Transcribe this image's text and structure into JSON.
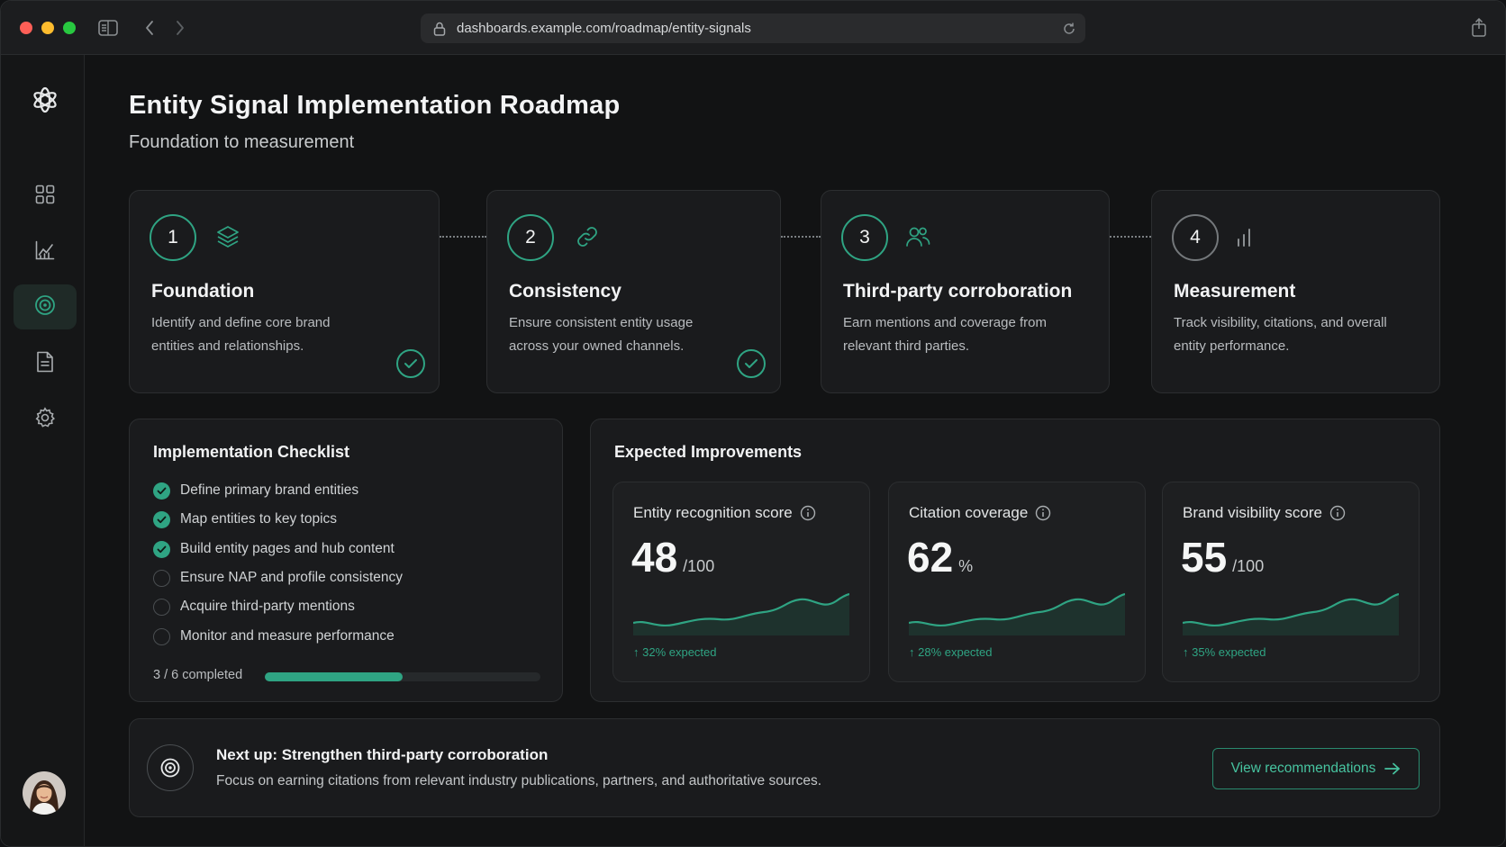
{
  "browser": {
    "url": "dashboards.example.com/roadmap/entity-signals"
  },
  "sidebar": {
    "items": [
      {
        "name": "dashboard",
        "icon": "grid-icon"
      },
      {
        "name": "analytics",
        "icon": "chart-icon"
      },
      {
        "name": "roadmap",
        "icon": "target-icon",
        "active": true
      },
      {
        "name": "documents",
        "icon": "document-icon"
      },
      {
        "name": "settings",
        "icon": "gear-icon"
      }
    ]
  },
  "page": {
    "title": "Entity Signal Implementation Roadmap",
    "subtitle": "Foundation to measurement"
  },
  "steps": [
    {
      "number": "1",
      "icon": "layers-icon",
      "title": "Foundation",
      "description": "Identify and define core brand entities and relationships.",
      "completed": true
    },
    {
      "number": "2",
      "icon": "link-icon",
      "title": "Consistency",
      "description": "Ensure consistent entity usage across your owned channels.",
      "completed": true
    },
    {
      "number": "3",
      "icon": "users-icon",
      "title": "Third-party corroboration",
      "description": "Earn mentions and coverage from relevant third parties.",
      "completed": false
    },
    {
      "number": "4",
      "icon": "bar-chart-icon",
      "title": "Measurement",
      "description": "Track visibility, citations, and overall entity performance.",
      "completed": false
    }
  ],
  "checklist": {
    "title": "Implementation Checklist",
    "items": [
      {
        "label": "Define primary brand entities",
        "done": true
      },
      {
        "label": "Map entities to key topics",
        "done": true
      },
      {
        "label": "Build entity pages and hub content",
        "done": true
      },
      {
        "label": "Ensure NAP and profile consistency",
        "done": false
      },
      {
        "label": "Acquire third-party mentions",
        "done": false
      },
      {
        "label": "Monitor and measure performance",
        "done": false
      }
    ],
    "progress_label": "3 / 6 completed",
    "progress_fraction": 0.5
  },
  "improvements": {
    "title": "Expected Improvements",
    "metrics": [
      {
        "label": "Entity recognition score",
        "value": "48",
        "unit": "/100",
        "delta": "↑ 32% expected"
      },
      {
        "label": "Citation coverage",
        "value": "62",
        "unit": "%",
        "delta": "↑ 28% expected"
      },
      {
        "label": "Brand visibility score",
        "value": "55",
        "unit": "/100",
        "delta": "↑ 35% expected"
      }
    ]
  },
  "next_up": {
    "title": "Next up: Strengthen third-party corroboration",
    "description": "Focus on earning citations from relevant industry publications, partners, and authoritative sources.",
    "button_label": "View recommendations"
  },
  "colors": {
    "accent": "#2fa483",
    "background": "#121314",
    "card": "#1a1b1d"
  }
}
